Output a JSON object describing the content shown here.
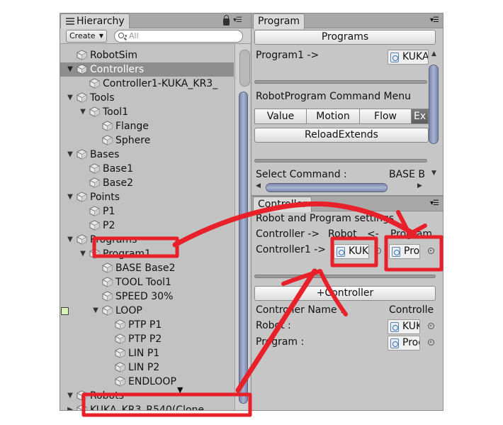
{
  "hierarchy": {
    "tab_label": "Hierarchy",
    "create_label": "Create",
    "search_placeholder": "All",
    "items": [
      {
        "label": "RobotSim",
        "fold": ""
      },
      {
        "label": "Controllers",
        "fold": "▼",
        "selected": true
      },
      {
        "label": "Controller1-KUKA_KR3_",
        "fold": ""
      },
      {
        "label": "Tools",
        "fold": "▼"
      },
      {
        "label": "Tool1",
        "fold": "▼"
      },
      {
        "label": "Flange",
        "fold": ""
      },
      {
        "label": "Sphere",
        "fold": ""
      },
      {
        "label": "Bases",
        "fold": "▼"
      },
      {
        "label": "Base1",
        "fold": ""
      },
      {
        "label": "Base2",
        "fold": ""
      },
      {
        "label": "Points",
        "fold": "▼"
      },
      {
        "label": "P1",
        "fold": ""
      },
      {
        "label": "P2",
        "fold": ""
      },
      {
        "label": "Programs",
        "fold": "▼"
      },
      {
        "label": "Program1",
        "fold": "▼"
      },
      {
        "label": "BASE Base2",
        "fold": ""
      },
      {
        "label": "TOOL Tool1",
        "fold": ""
      },
      {
        "label": "SPEED 30%",
        "fold": ""
      },
      {
        "label": "LOOP",
        "fold": "▼"
      },
      {
        "label": "PTP P1",
        "fold": ""
      },
      {
        "label": "PTP P2",
        "fold": ""
      },
      {
        "label": "LIN P1",
        "fold": ""
      },
      {
        "label": "LIN P2",
        "fold": ""
      },
      {
        "label": "ENDLOOP",
        "fold": ""
      },
      {
        "label": "Robots",
        "fold": "▼"
      },
      {
        "label": "KUKA_KR3_R540(Clone",
        "fold": "▶"
      }
    ]
  },
  "program": {
    "tab_label": "Program",
    "programs_button": "Programs",
    "program1_label": "Program1 ->",
    "program1_value": "KUKA",
    "command_menu_title": "RobotProgram Command Menu",
    "segments": [
      "Value",
      "Motion",
      "Flow",
      "Ex"
    ],
    "active_segment": "Ex",
    "reload_button": "ReloadExtends",
    "select_command_label": "Select Command :",
    "select_command_value": "BASE B"
  },
  "controller": {
    "tab_label": "Controller",
    "settings_title": "Robot and Program settings",
    "mapping_label_a": "Controller ->",
    "mapping_label_b": "Robot",
    "mapping_label_c": "<-",
    "mapping_label_d": "Program",
    "controller1_label": "Controller1 ->",
    "controller1_robot_value": "KUK",
    "controller1_program_value": "Prog",
    "add_controller_button": "+Controller",
    "controller_name_label": "Controller Name :",
    "controller_name_value": "Controller",
    "robot_label": "Robot :",
    "robot_value": "KUK",
    "program_label": "Program :",
    "program_value": "Prog"
  },
  "colors": {
    "annotation_red": "#e8202a",
    "selection_gray": "#8e8e8e",
    "scroll_thumb_blue": "#8d9abf",
    "panel_bg": "#c6c6c6"
  }
}
